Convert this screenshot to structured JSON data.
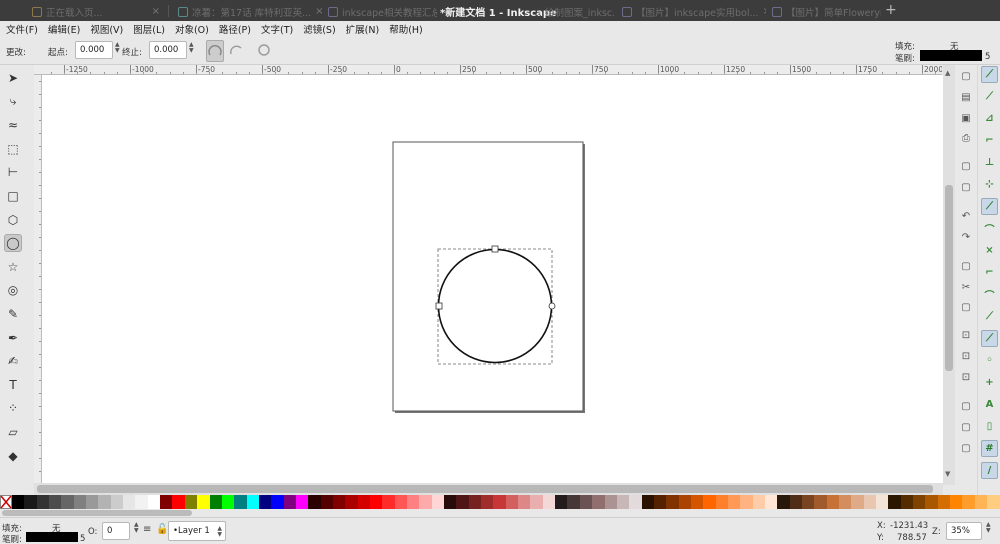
{
  "window": {
    "title": "*新建文档 1 - Inkscape",
    "tabs": [
      {
        "label": "正在载入页..."
      },
      {
        "label": "凉薯：第17话 库特利亚英..."
      },
      {
        "label": "inkscape相关教程汇总_..."
      },
      {
        "label": "...绘制图案_inksc..."
      },
      {
        "label": "【图片】inkscape实用bol..."
      },
      {
        "label": "【图片】简单Flowery的制作..."
      }
    ],
    "close_glyph": "×",
    "add_tab_glyph": "+"
  },
  "menu": [
    "文件(F)",
    "编辑(E)",
    "视图(V)",
    "图层(L)",
    "对象(O)",
    "路径(P)",
    "文字(T)",
    "滤镜(S)",
    "扩展(N)",
    "帮助(H)"
  ],
  "toolctrl": {
    "change_label": "更改:",
    "start_label": "起点:",
    "start_value": "0.000",
    "end_label": "终止:",
    "end_value": "0.000",
    "fill_label": "填充:",
    "fill_value": "无",
    "stroke_label": "笔刷:",
    "stroke_width": "5"
  },
  "ruler": {
    "labels": [
      "-1250",
      "-1000",
      "-750",
      "-500",
      "-250",
      "0",
      "250",
      "500",
      "750",
      "1000",
      "1250",
      "1500",
      "1750",
      "2000"
    ]
  },
  "tools": [
    {
      "name": "selector-tool-icon",
      "glyph": "➤"
    },
    {
      "name": "node-tool-icon",
      "glyph": "⤷"
    },
    {
      "name": "tweak-tool-icon",
      "glyph": "≈"
    },
    {
      "name": "zoom-tool-icon",
      "glyph": "⬚"
    },
    {
      "name": "measure-tool-icon",
      "glyph": "⊢"
    },
    {
      "name": "rectangle-tool-icon",
      "glyph": "□"
    },
    {
      "name": "3dbox-tool-icon",
      "glyph": "⬡"
    },
    {
      "name": "ellipse-tool-icon",
      "glyph": "◯"
    },
    {
      "name": "star-tool-icon",
      "glyph": "☆"
    },
    {
      "name": "spiral-tool-icon",
      "glyph": "◎"
    },
    {
      "name": "pencil-tool-icon",
      "glyph": "✎"
    },
    {
      "name": "pen-tool-icon",
      "glyph": "✒"
    },
    {
      "name": "calligraphy-tool-icon",
      "glyph": "✍"
    },
    {
      "name": "text-tool-icon",
      "glyph": "T"
    },
    {
      "name": "spray-tool-icon",
      "glyph": "⁘"
    },
    {
      "name": "eraser-tool-icon",
      "glyph": "▱"
    },
    {
      "name": "bucket-tool-icon",
      "glyph": "◆"
    }
  ],
  "commands": [
    {
      "name": "new-document-icon",
      "glyph": "▢"
    },
    {
      "name": "open-icon",
      "glyph": "▤"
    },
    {
      "name": "save-icon",
      "glyph": "▣"
    },
    {
      "name": "print-icon",
      "glyph": "⎙"
    },
    {
      "name": "import-icon",
      "glyph": "▢"
    },
    {
      "name": "export-icon",
      "glyph": "▢"
    },
    {
      "name": "undo-icon",
      "glyph": "↶"
    },
    {
      "name": "redo-icon",
      "glyph": "↷"
    },
    {
      "name": "copy-icon",
      "glyph": "▢"
    },
    {
      "name": "cut-icon",
      "glyph": "✂"
    },
    {
      "name": "paste-icon",
      "glyph": "▢"
    },
    {
      "name": "zoom-selection-icon",
      "glyph": "⊡"
    },
    {
      "name": "zoom-drawing-icon",
      "glyph": "⊡"
    },
    {
      "name": "zoom-page-icon",
      "glyph": "⊡"
    },
    {
      "name": "duplicate-icon",
      "glyph": "▢"
    },
    {
      "name": "clone-icon",
      "glyph": "▢"
    },
    {
      "name": "unlink-clone-icon",
      "glyph": "▢"
    }
  ],
  "snaps": [
    {
      "name": "snap-enable-icon",
      "glyph": "⟋",
      "on": true
    },
    {
      "name": "snap-bbox-icon",
      "glyph": "⟋",
      "on": false
    },
    {
      "name": "snap-bbox-edge-icon",
      "glyph": "⊿",
      "on": false
    },
    {
      "name": "snap-bbox-corner-icon",
      "glyph": "⌐",
      "on": false
    },
    {
      "name": "snap-bbox-midpoint-icon",
      "glyph": "⊥",
      "on": false
    },
    {
      "name": "snap-bbox-center-icon",
      "glyph": "⊹",
      "on": false
    },
    {
      "name": "snap-nodes-icon",
      "glyph": "⟋",
      "on": true
    },
    {
      "name": "snap-paths-icon",
      "glyph": "⌒",
      "on": false
    },
    {
      "name": "snap-path-intersection-icon",
      "glyph": "⨯",
      "on": false
    },
    {
      "name": "snap-cusp-nodes-icon",
      "glyph": "⌐",
      "on": false
    },
    {
      "name": "snap-smooth-nodes-icon",
      "glyph": "⌒",
      "on": false
    },
    {
      "name": "snap-midpoints-icon",
      "glyph": "⟋",
      "on": false
    },
    {
      "name": "snap-others-icon",
      "glyph": "⟋",
      "on": true
    },
    {
      "name": "snap-object-center-icon",
      "glyph": "◦",
      "on": false
    },
    {
      "name": "snap-rotation-center-icon",
      "glyph": "+",
      "on": false
    },
    {
      "name": "snap-text-baseline-icon",
      "glyph": "A",
      "on": false
    },
    {
      "name": "snap-page-border-icon",
      "glyph": "▯",
      "on": false
    },
    {
      "name": "snap-grid-icon",
      "glyph": "#",
      "on": true
    },
    {
      "name": "snap-guide-icon",
      "glyph": "/",
      "on": true
    }
  ],
  "palette": [
    "#000000",
    "#1a1a1a",
    "#333333",
    "#4d4d4d",
    "#666666",
    "#808080",
    "#999999",
    "#b3b3b3",
    "#cccccc",
    "#e6e6e6",
    "#f2f2f2",
    "#ffffff",
    "#800000",
    "#ff0000",
    "#808000",
    "#ffff00",
    "#008000",
    "#00ff00",
    "#008080",
    "#00ffff",
    "#000080",
    "#0000ff",
    "#800080",
    "#ff00ff",
    "#2b0000",
    "#550000",
    "#800000",
    "#aa0000",
    "#d40000",
    "#ff0000",
    "#ff2a2a",
    "#ff5555",
    "#ff8080",
    "#ffaaaa",
    "#ffd5d5",
    "#280b0b",
    "#501616",
    "#782121",
    "#a02c2c",
    "#c83737",
    "#d35f5f",
    "#de8787",
    "#e9afaf",
    "#f4d7d7",
    "#241c1c",
    "#483737",
    "#6c5353",
    "#916f6f",
    "#ac9393",
    "#c8b7b7",
    "#e3dbdb",
    "#2b1100",
    "#552200",
    "#803300",
    "#aa4400",
    "#d45500",
    "#ff6600",
    "#ff7f2a",
    "#ff9955",
    "#ffb380",
    "#ffccaa",
    "#ffe6d5",
    "#28170b",
    "#502d16",
    "#784421",
    "#a05a2c",
    "#c87137",
    "#d38d5f",
    "#deaa87",
    "#e9c6af",
    "#f4e3d7",
    "#2b1700",
    "#552c00",
    "#804200",
    "#aa5800",
    "#d46e00",
    "#ff8400",
    "#ff9d2a",
    "#ffb555",
    "#ffcd80"
  ],
  "status": {
    "fill_label": "填充:",
    "fill_value": "无",
    "stroke_label": "笔刷:",
    "stroke_width": "5",
    "opacity_label": "O:",
    "opacity_value": "0",
    "layer": "•Layer 1",
    "x_label": "X:",
    "x_value": "-1231.43",
    "y_label": "Y:",
    "y_value": "788.57",
    "zoom_label": "Z:",
    "zoom_value": "35%"
  }
}
